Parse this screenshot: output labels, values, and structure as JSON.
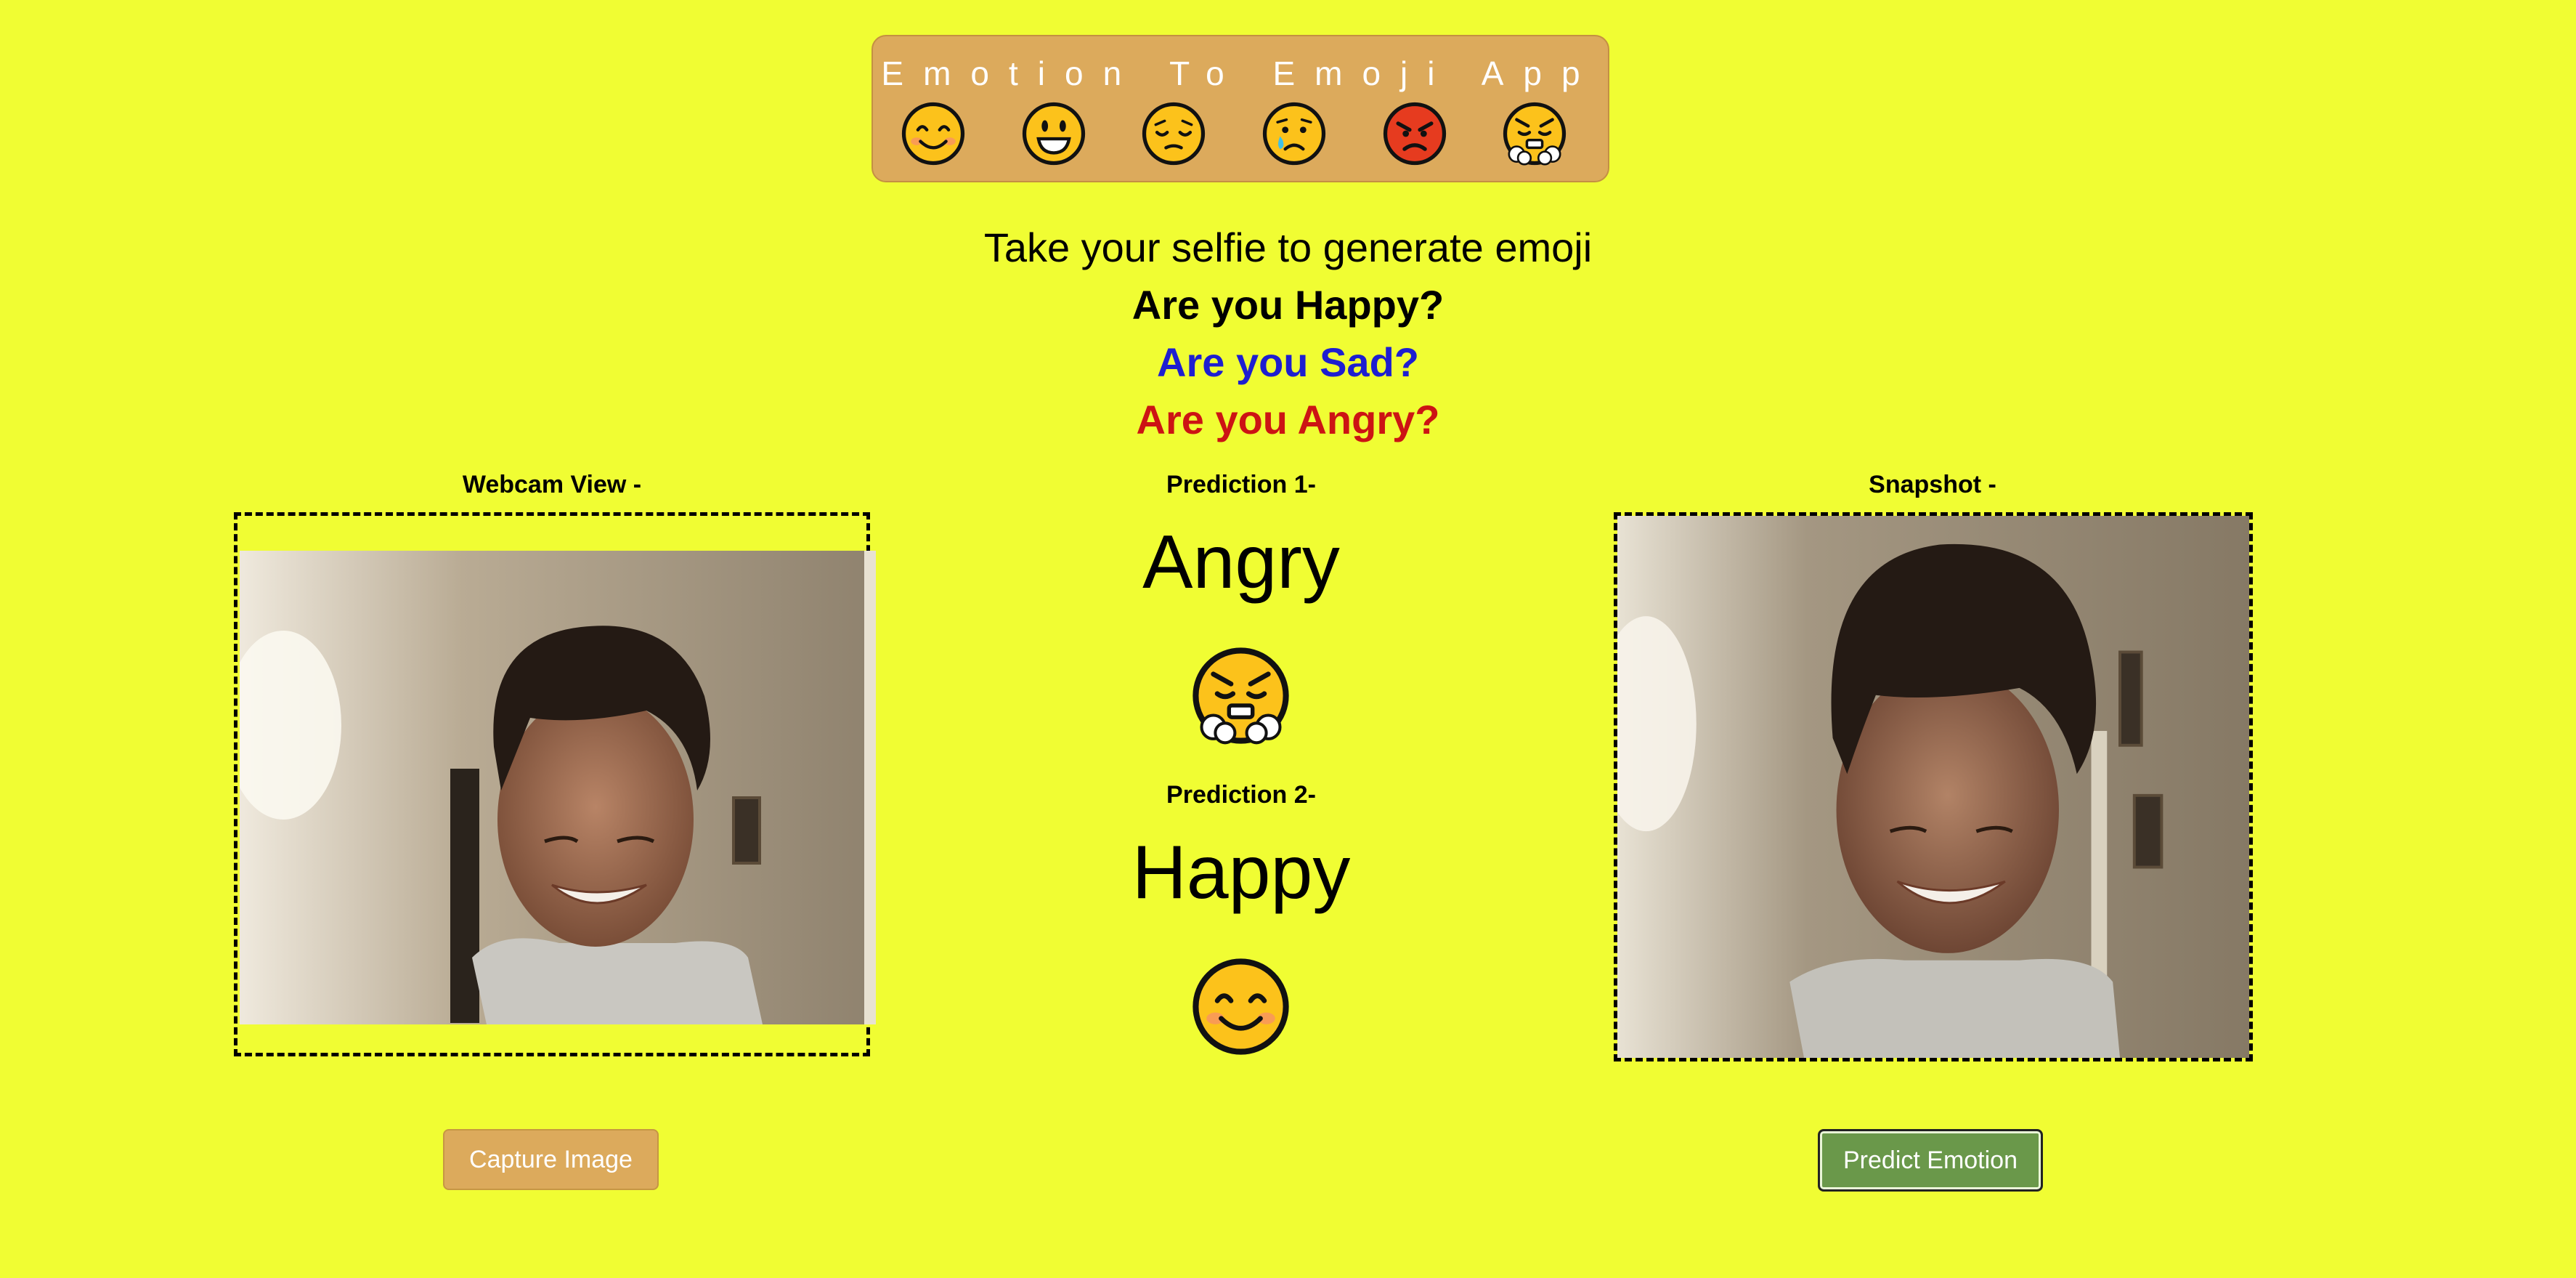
{
  "header": {
    "title": "Emotion To Emoji App",
    "emojis": [
      "smiling-face",
      "grinning-face",
      "pensive-face",
      "crying-face",
      "angry-face",
      "steam-from-nose-face"
    ]
  },
  "prompt": {
    "subtitle": "Take your selfie to generate emoji",
    "question_happy": "Are you Happy?",
    "question_sad": "Are you Sad?",
    "question_angry": "Are you Angry?"
  },
  "webcam": {
    "label": "Webcam View -"
  },
  "snapshot": {
    "label": "Snapshot -"
  },
  "predictions": [
    {
      "label": "Prediction 1-",
      "emotion": "Angry",
      "emoji": "steam-from-nose-face"
    },
    {
      "label": "Prediction 2-",
      "emotion": "Happy",
      "emoji": "smiling-face"
    }
  ],
  "buttons": {
    "capture": "Capture Image",
    "predict": "Predict Emotion"
  },
  "colors": {
    "background": "#f0fd33",
    "header": "#dcaa5c",
    "sad_text": "#1e1ed0",
    "angry_text": "#cc1414",
    "predict_button": "#6a984a"
  }
}
